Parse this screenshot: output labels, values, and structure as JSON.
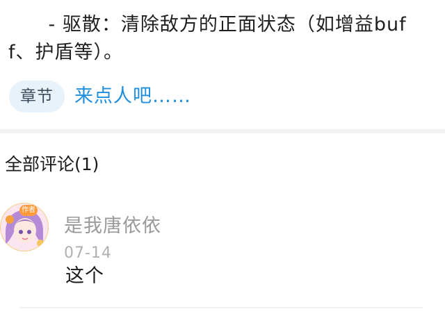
{
  "article": {
    "text": "      - 驱散：清除敌方的正面状态（如增益buff、护盾等）。"
  },
  "chapter": {
    "tag_label": "章节",
    "link_text": "来点人吧……"
  },
  "comments": {
    "header": "全部评论(1)",
    "items": [
      {
        "avatar_icon": "anime-girl-avatar-icon",
        "badge": "作者",
        "author": "是我唐依依",
        "date": "07-14",
        "text": "这个"
      }
    ]
  },
  "colors": {
    "link": "#1f8ee0",
    "tag_background": "#e7f2fb",
    "muted_text": "#9a9a9a"
  }
}
